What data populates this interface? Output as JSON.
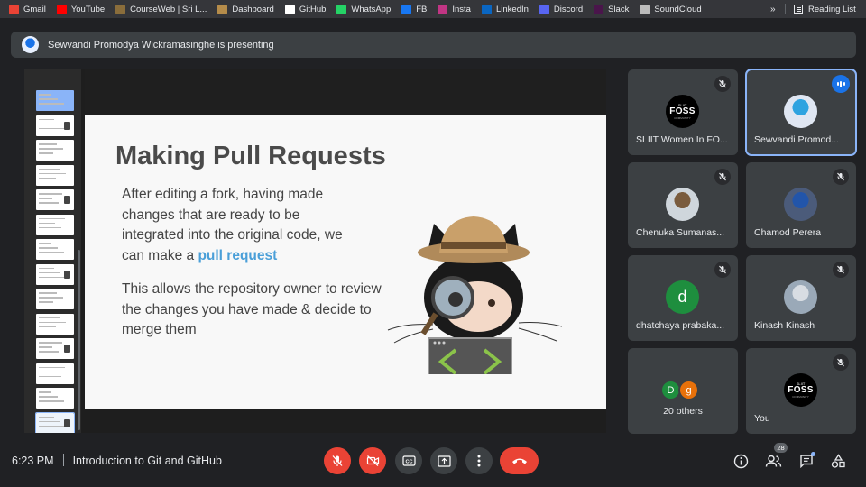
{
  "bookmarks": [
    {
      "label": "Gmail",
      "icon": "gmail-icon",
      "color": "#ea4335"
    },
    {
      "label": "YouTube",
      "icon": "youtube-icon",
      "color": "#ff0000"
    },
    {
      "label": "CourseWeb | Sri L...",
      "icon": "courseweb-icon",
      "color": "#8a6d3b"
    },
    {
      "label": "Dashboard",
      "icon": "dashboard-icon",
      "color": "#b58c4a"
    },
    {
      "label": "GitHub",
      "icon": "github-icon",
      "color": "#ffffff"
    },
    {
      "label": "WhatsApp",
      "icon": "whatsapp-icon",
      "color": "#25d366"
    },
    {
      "label": "FB",
      "icon": "facebook-icon",
      "color": "#1877f2"
    },
    {
      "label": "Insta",
      "icon": "instagram-icon",
      "color": "#c13584"
    },
    {
      "label": "LinkedIn",
      "icon": "linkedin-icon",
      "color": "#0a66c2"
    },
    {
      "label": "Discord",
      "icon": "discord-icon",
      "color": "#5865f2"
    },
    {
      "label": "Slack",
      "icon": "slack-icon",
      "color": "#4a154b"
    },
    {
      "label": "SoundCloud",
      "icon": "soundcloud-icon",
      "color": "#bbbbbb"
    }
  ],
  "bookmarks_more": "»",
  "reading_list": "Reading List",
  "presenting": "Sewvandi Promodya Wickramasinghe is presenting",
  "slide": {
    "title": "Making Pull Requests",
    "para1_text": "After editing a fork, having made changes that are ready to be integrated into the original code, we can make a ",
    "para1_accent": "pull request",
    "para2": "This allows the repository owner to review the changes you have made & decide to merge them"
  },
  "participants": [
    {
      "name": "SLIIT Women In FO...",
      "avatar": "foss-logo",
      "muted": true
    },
    {
      "name": "Sewvandi Promod...",
      "avatar": "photo",
      "speaking": true
    },
    {
      "name": "Chenuka Sumanas...",
      "avatar": "photo",
      "muted": true
    },
    {
      "name": "Chamod Perera",
      "avatar": "photo",
      "muted": true
    },
    {
      "name": "dhatchaya prabaka...",
      "avatar": "letter",
      "letter": "d",
      "muted": true
    },
    {
      "name": "Kinash Kinash",
      "avatar": "photo",
      "muted": true
    },
    {
      "name": "20 others",
      "avatar": "group",
      "letters": [
        "D",
        "g"
      ]
    },
    {
      "name": "You",
      "avatar": "foss-logo",
      "muted": true
    }
  ],
  "foss_logo": {
    "small": "SLIIT",
    "big": "FOSS",
    "tag": "COMMUNITY"
  },
  "bottom": {
    "time": "6:23 PM",
    "meeting": "Introduction to Git and GitHub",
    "people_count": "28"
  },
  "colors": {
    "bg": "#202124",
    "tile": "#3c4043",
    "danger": "#ea4335",
    "accent": "#8ab4f8",
    "slide_accent": "#4a9fd8"
  }
}
